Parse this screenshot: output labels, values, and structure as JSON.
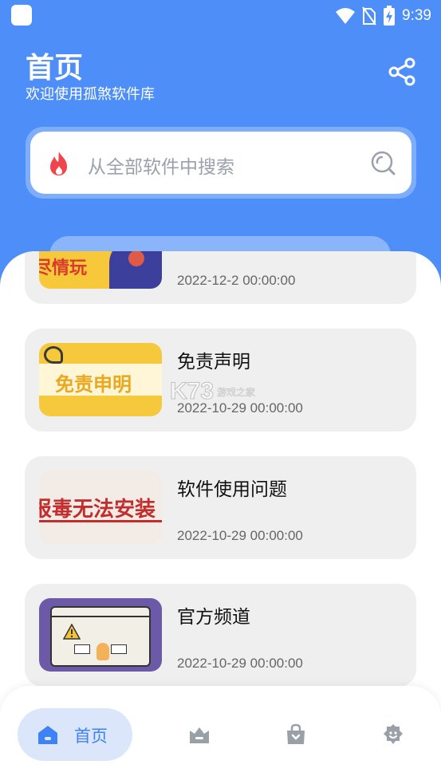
{
  "status_bar": {
    "time": "9:39"
  },
  "header": {
    "title": "首页",
    "subtitle": "欢迎使用孤煞软件库"
  },
  "search": {
    "placeholder": "从全部软件中搜索"
  },
  "articles": [
    {
      "title": "",
      "thumb_text": "尽情玩",
      "date": "2022-12-2 00:00:00"
    },
    {
      "title": "免责声明",
      "thumb_text": "免责申明",
      "date": "2022-10-29 00:00:00"
    },
    {
      "title": "软件使用问题",
      "thumb_text": "报毒无法安装",
      "date": "2022-10-29 00:00:00"
    },
    {
      "title": "官方频道",
      "thumb_text": "",
      "date": "2022-10-29 00:00:00"
    }
  ],
  "watermark": {
    "brand": "K73",
    "tagline": "游戏之家"
  },
  "bottom_nav": {
    "items": [
      {
        "label": "首页",
        "icon": "home-icon",
        "active": true
      },
      {
        "label": "",
        "icon": "crown-icon",
        "active": false
      },
      {
        "label": "",
        "icon": "bag-icon",
        "active": false
      },
      {
        "label": "",
        "icon": "profile-icon",
        "active": false
      }
    ]
  },
  "colors": {
    "primary": "#4d8ef8",
    "nav_active_bg": "#dbe6fb",
    "nav_active_text": "#3f82f5",
    "card_bg": "#efefef",
    "inactive_icon": "#9aa0a8"
  }
}
